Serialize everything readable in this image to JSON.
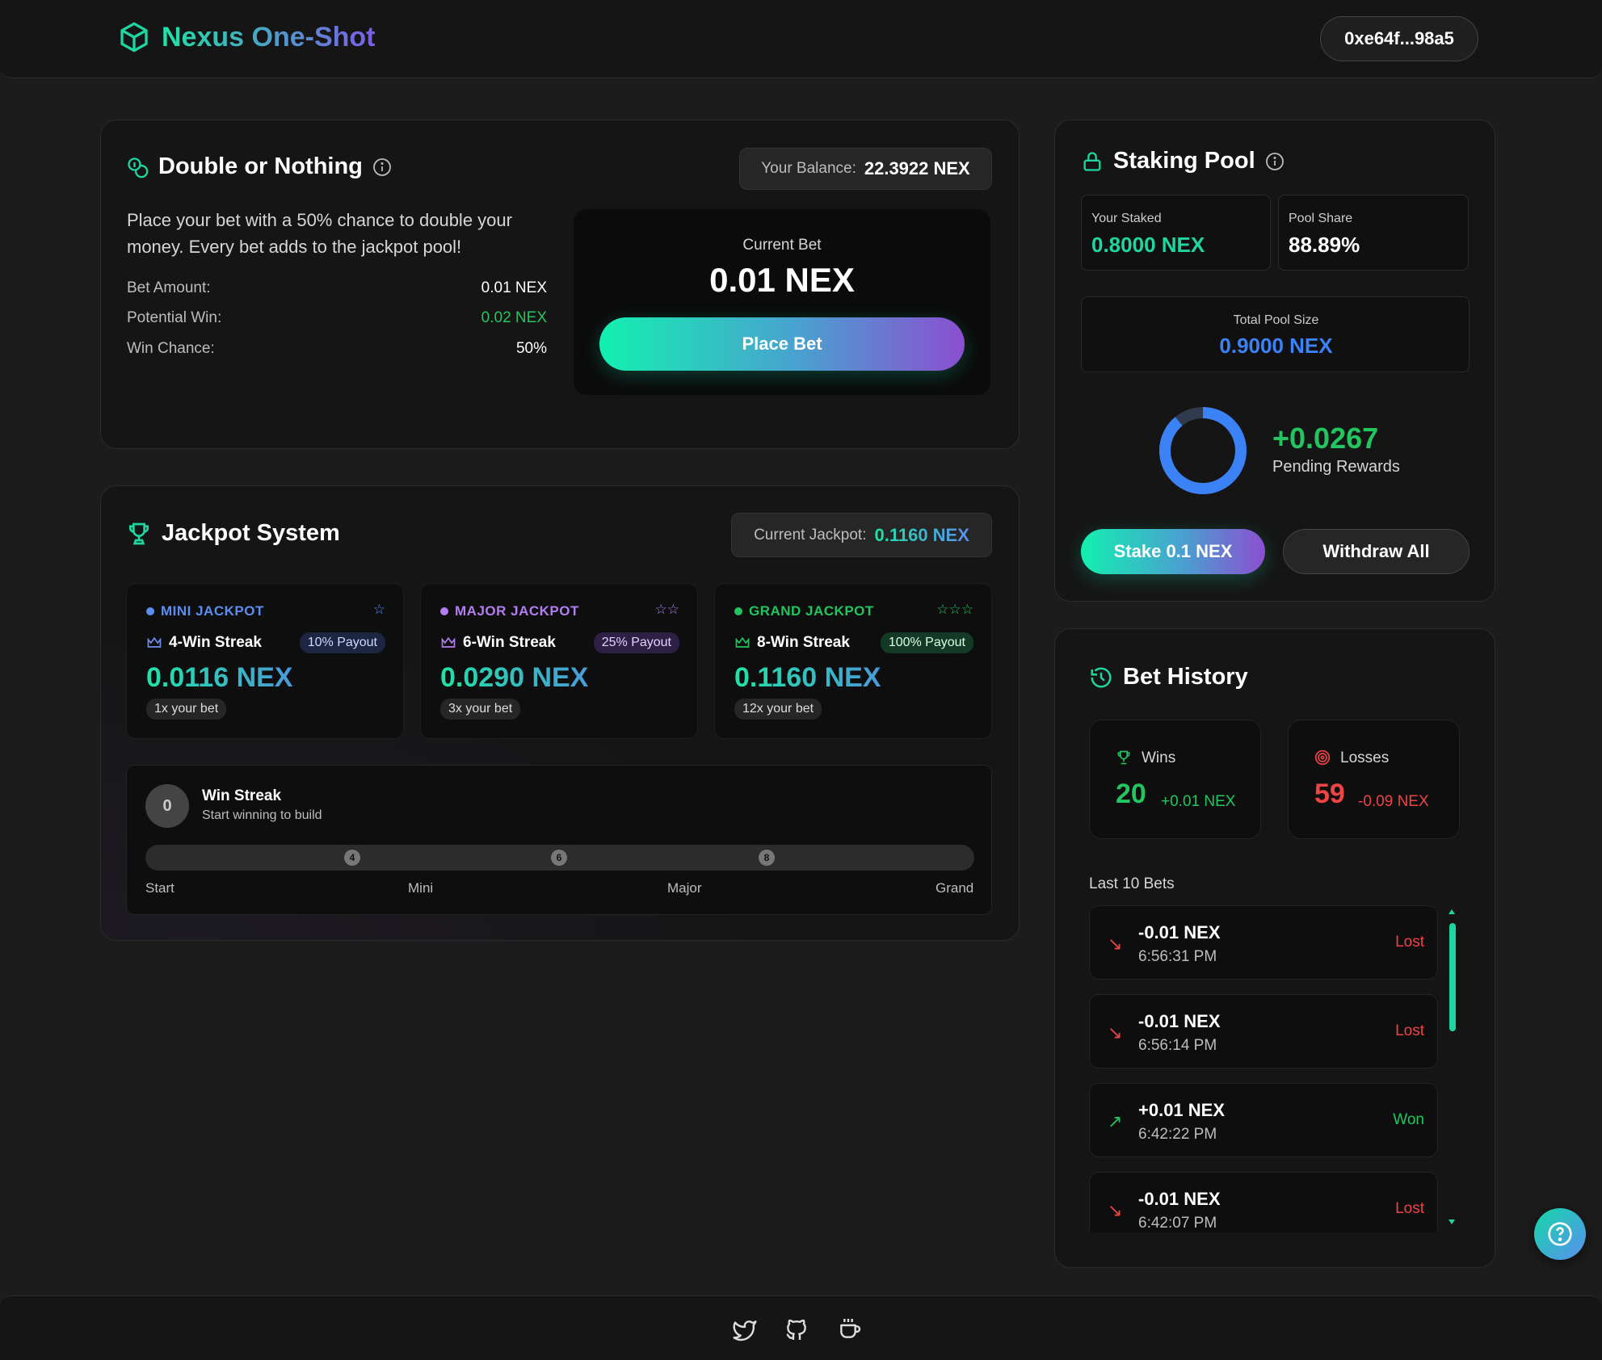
{
  "app": {
    "title": "Nexus One-Shot",
    "wallet": "0xe64f...98a5"
  },
  "double": {
    "title": "Double or Nothing",
    "balance_label": "Your Balance:",
    "balance_value": "22.3922 NEX",
    "description": "Place your bet with a 50% chance to double your money. Every bet adds to the jackpot pool!",
    "rows": [
      {
        "label": "Bet Amount:",
        "value": "0.01 NEX"
      },
      {
        "label": "Potential Win:",
        "value": "0.02 NEX"
      },
      {
        "label": "Win Chance:",
        "value": "50%"
      }
    ],
    "current_bet_label": "Current Bet",
    "current_bet_value": "0.01 NEX",
    "place_bet_label": "Place Bet"
  },
  "jackpot": {
    "title": "Jackpot System",
    "current_label": "Current Jackpot:",
    "current_value": "0.1160 NEX",
    "tiers": [
      {
        "name": "MINI JACKPOT",
        "stars": "☆",
        "color": "#5b8ef0",
        "streak": "4-Win Streak",
        "payout": "10% Payout",
        "value": "0.0116 NEX",
        "mult": "1x your bet"
      },
      {
        "name": "MAJOR JACKPOT",
        "stars": "☆☆",
        "color": "#b27ef0",
        "streak": "6-Win Streak",
        "payout": "25% Payout",
        "value": "0.0290 NEX",
        "mult": "3x your bet"
      },
      {
        "name": "GRAND JACKPOT",
        "stars": "☆☆☆",
        "color": "#22c55e",
        "streak": "8-Win Streak",
        "payout": "100% Payout",
        "value": "0.1160 NEX",
        "mult": "12x your bet"
      }
    ],
    "streak_count": "0",
    "streak_title": "Win Streak",
    "streak_sub": "Start winning to build",
    "progress": 0,
    "milestones": [
      "4",
      "6",
      "8"
    ],
    "bar_labels": [
      "Start",
      "Mini",
      "Major",
      "Grand"
    ]
  },
  "staking": {
    "title": "Staking Pool",
    "your_staked_label": "Your Staked",
    "your_staked_value": "0.8000 NEX",
    "pool_share_label": "Pool Share",
    "pool_share_value": "88.89%",
    "total_label": "Total Pool Size",
    "total_value": "0.9000 NEX",
    "pending_value": "+0.0267",
    "pending_label": "Pending Rewards",
    "donut_share": 0.8889,
    "stake_label": "Stake 0.1 NEX",
    "withdraw_label": "Withdraw All"
  },
  "history": {
    "title": "Bet History",
    "wins_label": "Wins",
    "wins_count": "20",
    "wins_amount": "+0.01 NEX",
    "losses_label": "Losses",
    "losses_count": "59",
    "losses_amount": "-0.09 NEX",
    "last_label": "Last 10 Bets",
    "items": [
      {
        "amount": "-0.01 NEX",
        "time": "6:56:31 PM",
        "status": "Lost"
      },
      {
        "amount": "-0.01 NEX",
        "time": "6:56:14 PM",
        "status": "Lost"
      },
      {
        "amount": "+0.01 NEX",
        "time": "6:42:22 PM",
        "status": "Won"
      },
      {
        "amount": "-0.01 NEX",
        "time": "6:42:07 PM",
        "status": "Lost"
      }
    ]
  },
  "colors": {
    "accent_green": "#22c55e",
    "accent_red": "#ef4444",
    "accent_teal": "#1fd6a0",
    "accent_blue": "#3b82f6"
  },
  "footer": {
    "icons": [
      "twitter-icon",
      "github-icon",
      "coffee-icon"
    ]
  }
}
